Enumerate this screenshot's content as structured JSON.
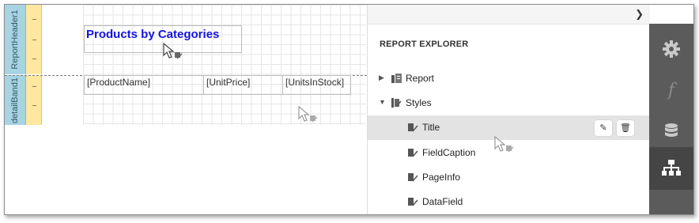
{
  "bands": {
    "report_header": "ReportHeader1",
    "detail": "detailBand1"
  },
  "designer": {
    "title_text": "Products by Categories",
    "fields": [
      "[ProductName]",
      "[UnitPrice]",
      "[UnitsInStock]"
    ]
  },
  "explorer": {
    "title": "REPORT EXPLORER",
    "collapse_icon": "chevron-right-icon",
    "tree": {
      "report": "Report",
      "styles": "Styles",
      "style_items": [
        "Title",
        "FieldCaption",
        "PageInfo",
        "DataField"
      ],
      "selected": "Title"
    },
    "row_actions": [
      "edit-icon",
      "delete-icon"
    ]
  },
  "toolbar": {
    "buttons": [
      "gear-icon",
      "function-icon",
      "database-icon",
      "report-explorer-icon"
    ],
    "active": "report-explorer-icon"
  },
  "colors": {
    "band_strip": "#a7d4e3",
    "ruler": "#ffe7a0",
    "title_text": "#1414e0",
    "toolbar_bg": "#5b5b5b",
    "selected_row": "#e3e3e3"
  }
}
